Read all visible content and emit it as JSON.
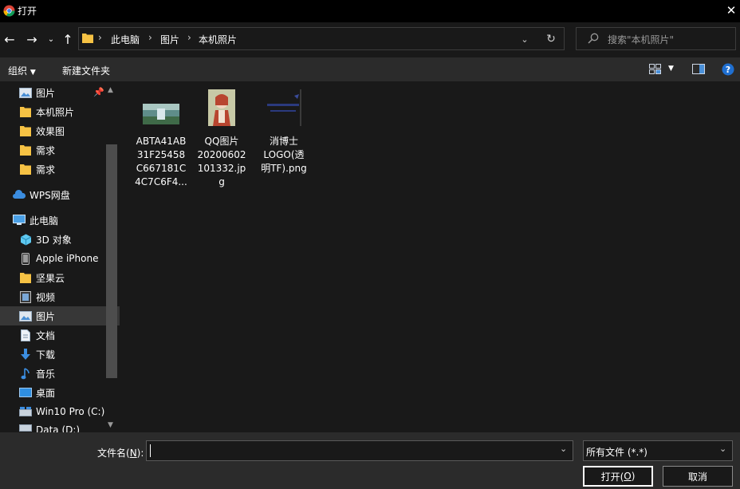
{
  "window": {
    "title": "打开"
  },
  "address": {
    "crumbs": [
      "此电脑",
      "图片",
      "本机照片"
    ]
  },
  "search": {
    "placeholder": "搜索\"本机照片\""
  },
  "toolbar": {
    "organize": "组织",
    "new_folder": "新建文件夹"
  },
  "sidebar": {
    "items": [
      {
        "label": "图片",
        "icon": "pictures-icon"
      },
      {
        "label": "本机照片",
        "icon": "folder-icon"
      },
      {
        "label": "效果图",
        "icon": "folder-icon"
      },
      {
        "label": "需求",
        "icon": "folder-icon"
      },
      {
        "label": "需求",
        "icon": "folder-icon"
      },
      {
        "label": "WPS网盘",
        "icon": "cloud-icon"
      },
      {
        "label": "此电脑",
        "icon": "computer-icon"
      },
      {
        "label": "3D 对象",
        "icon": "cube-icon"
      },
      {
        "label": "Apple iPhone",
        "icon": "phone-icon"
      },
      {
        "label": "坚果云",
        "icon": "folder-icon"
      },
      {
        "label": "视频",
        "icon": "video-icon"
      },
      {
        "label": "图片",
        "icon": "pictures-icon"
      },
      {
        "label": "文档",
        "icon": "document-icon"
      },
      {
        "label": "下载",
        "icon": "download-icon"
      },
      {
        "label": "音乐",
        "icon": "music-icon"
      },
      {
        "label": "桌面",
        "icon": "desktop-icon"
      },
      {
        "label": "Win10 Pro (C:)",
        "icon": "drive-icon"
      },
      {
        "label": "Data (D:)",
        "icon": "drive-icon"
      }
    ]
  },
  "files": [
    {
      "name_l1": "ABTA41AB",
      "name_l2": "31F25458",
      "name_l3": "C667181C",
      "name_l4": "4C7C6F4..."
    },
    {
      "name_l1": "QQ图片",
      "name_l2": "20200602",
      "name_l3": "101332.jp",
      "name_l4": "g"
    },
    {
      "name_l1": "消博士",
      "name_l2": "LOGO(透",
      "name_l3": "明TF).png",
      "name_l4": ""
    }
  ],
  "footer": {
    "filename_label": "文件名(",
    "filename_key": "N",
    "filename_label_end": "):",
    "filename_value": "",
    "filetype_value": "所有文件 (*.*)",
    "open_label": "打开(",
    "open_key": "O",
    "open_label_end": ")",
    "cancel_label": "取消"
  }
}
